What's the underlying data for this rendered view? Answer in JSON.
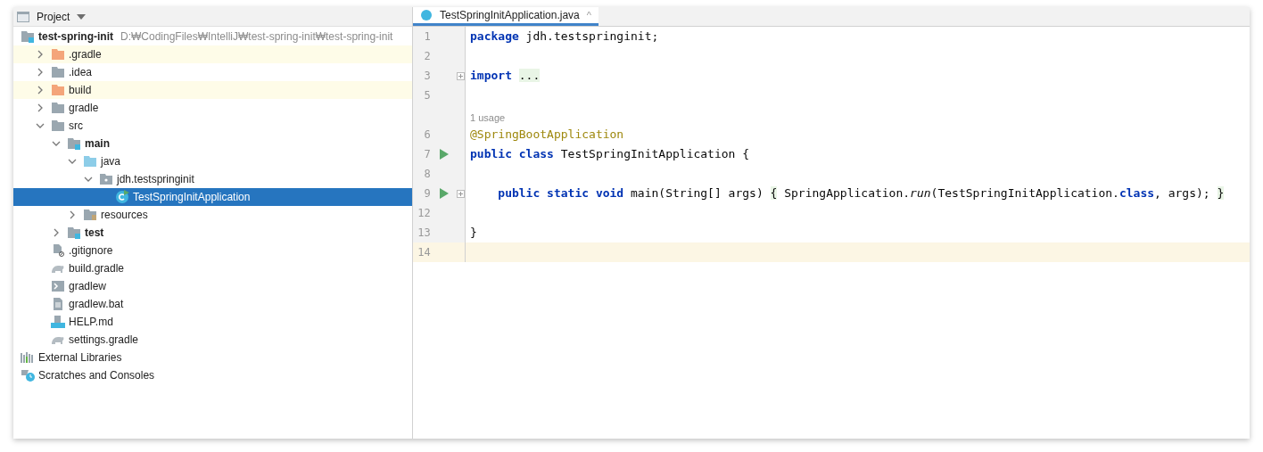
{
  "project_panel": {
    "title": "Project"
  },
  "tree": [
    {
      "label": "test-spring-init",
      "kind": "module",
      "bold": true,
      "path": "D:₩CodingFiles₩IntelliJ₩test-spring-init₩test-spring-init",
      "selected": false,
      "ignored": false,
      "children": [
        {
          "label": ".gradle",
          "kind": "folder-excluded",
          "expanded": false,
          "selected": false,
          "ignored": true
        },
        {
          "label": ".idea",
          "kind": "folder",
          "expanded": false,
          "selected": false,
          "ignored": false
        },
        {
          "label": "build",
          "kind": "folder-excluded",
          "expanded": false,
          "selected": false,
          "ignored": true
        },
        {
          "label": "gradle",
          "kind": "folder",
          "expanded": false,
          "selected": false,
          "ignored": false
        },
        {
          "label": "src",
          "kind": "folder",
          "expanded": true,
          "selected": false,
          "ignored": false,
          "children": [
            {
              "label": "main",
              "kind": "module-folder",
              "bold": true,
              "expanded": true,
              "selected": false,
              "ignored": false,
              "children": [
                {
                  "label": "java",
                  "kind": "source-folder",
                  "expanded": true,
                  "selected": false,
                  "ignored": false,
                  "children": [
                    {
                      "label": "jdh.testspringinit",
                      "kind": "package",
                      "expanded": true,
                      "selected": false,
                      "ignored": false,
                      "children": [
                        {
                          "label": "TestSpringInitApplication",
                          "kind": "class",
                          "selected": true,
                          "ignored": false
                        }
                      ]
                    }
                  ]
                },
                {
                  "label": "resources",
                  "kind": "resources",
                  "expanded": false,
                  "selected": false,
                  "ignored": false
                }
              ]
            },
            {
              "label": "test",
              "kind": "module-folder",
              "bold": true,
              "expanded": false,
              "selected": false,
              "ignored": false
            }
          ]
        },
        {
          "label": ".gitignore",
          "kind": "ignore-file",
          "selected": false,
          "ignored": false
        },
        {
          "label": "build.gradle",
          "kind": "gradle",
          "selected": false,
          "ignored": false
        },
        {
          "label": "gradlew",
          "kind": "script",
          "selected": false,
          "ignored": false
        },
        {
          "label": "gradlew.bat",
          "kind": "text",
          "selected": false,
          "ignored": false
        },
        {
          "label": "HELP.md",
          "kind": "markdown",
          "selected": false,
          "ignored": false
        },
        {
          "label": "settings.gradle",
          "kind": "gradle",
          "selected": false,
          "ignored": false
        }
      ]
    },
    {
      "label": "External Libraries",
      "kind": "libraries",
      "selected": false,
      "ignored": false
    },
    {
      "label": "Scratches and Consoles",
      "kind": "scratches",
      "selected": false,
      "ignored": false
    }
  ],
  "editor_tab": {
    "label": "TestSpringInitApplication.java",
    "close": "^"
  },
  "code_lines": [
    {
      "kind": "code",
      "number": "1",
      "run": false,
      "fold": false,
      "current": false,
      "tokens": [
        {
          "text": "package",
          "kind": "keyword"
        },
        {
          "text": " jdh.testspringinit;",
          "kind": "plain"
        }
      ]
    },
    {
      "kind": "code",
      "number": "2",
      "run": false,
      "fold": false,
      "current": false
    },
    {
      "kind": "code",
      "number": "3",
      "run": false,
      "fold": true,
      "current": false,
      "tokens": [
        {
          "text": "import ",
          "kind": "keyword"
        },
        {
          "text": "...",
          "kind": "folded"
        }
      ]
    },
    {
      "kind": "code",
      "number": "5",
      "run": false,
      "fold": false,
      "current": false
    },
    {
      "kind": "hint",
      "text": "1 usage"
    },
    {
      "kind": "code",
      "number": "6",
      "run": false,
      "fold": false,
      "current": false,
      "tokens": [
        {
          "text": "@SpringBootApplication",
          "kind": "annotation"
        }
      ]
    },
    {
      "kind": "code",
      "number": "7",
      "run": true,
      "fold": false,
      "current": false,
      "tokens": [
        {
          "text": "public class",
          "kind": "keyword"
        },
        {
          "text": " TestSpringInitApplication {",
          "kind": "plain"
        }
      ]
    },
    {
      "kind": "code",
      "number": "8",
      "run": false,
      "fold": false,
      "current": false
    },
    {
      "kind": "code",
      "number": "9",
      "run": true,
      "fold": true,
      "current": false,
      "tokens": [
        {
          "text": "    public static void",
          "kind": "keyword"
        },
        {
          "text": " main(String[] args) ",
          "kind": "plain"
        },
        {
          "text": "{",
          "kind": "folded"
        },
        {
          "text": " SpringApplication.",
          "kind": "plain"
        },
        {
          "text": "run",
          "kind": "italic"
        },
        {
          "text": "(TestSpringInitApplication.",
          "kind": "plain"
        },
        {
          "text": "class",
          "kind": "keyword"
        },
        {
          "text": ", args); ",
          "kind": "plain"
        },
        {
          "text": "}",
          "kind": "folded"
        }
      ]
    },
    {
      "kind": "code",
      "number": "12",
      "run": false,
      "fold": false,
      "current": false
    },
    {
      "kind": "code",
      "number": "13",
      "run": false,
      "fold": false,
      "current": false,
      "tokens": [
        {
          "text": "}",
          "kind": "plain"
        }
      ]
    },
    {
      "kind": "code",
      "number": "14",
      "run": false,
      "fold": false,
      "current": true
    }
  ]
}
